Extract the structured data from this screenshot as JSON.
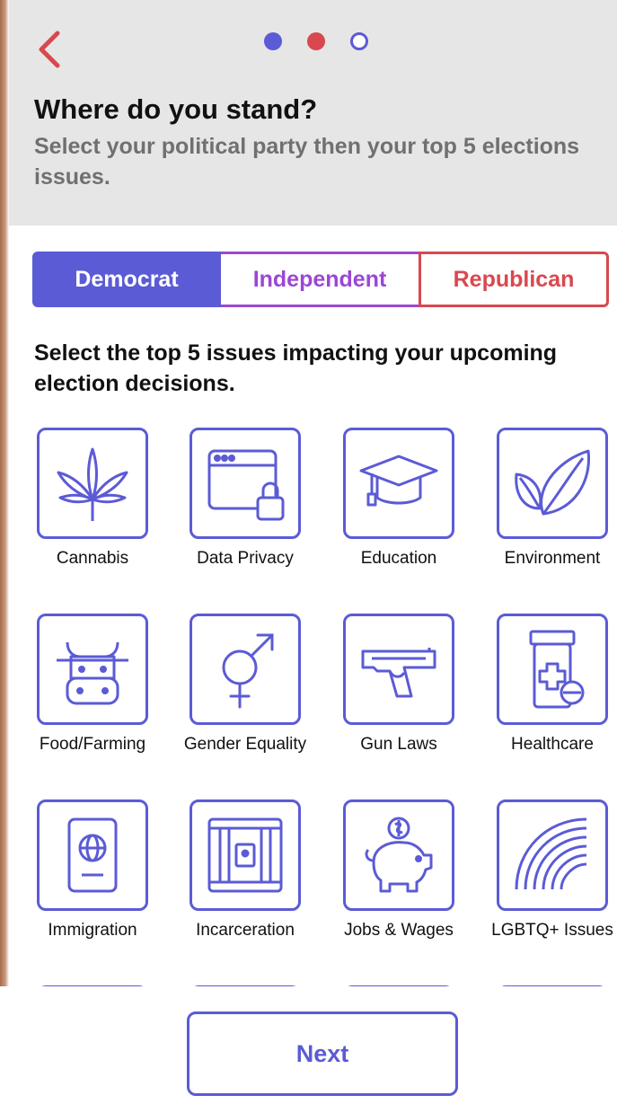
{
  "header": {
    "title": "Where do you stand?",
    "subtitle": "Select your political party then your top 5 elections issues.",
    "back_icon": "chevron-left-icon",
    "progress_dots": [
      {
        "state": "done",
        "color": "#5b5bd6"
      },
      {
        "state": "current",
        "color": "#d9484f"
      },
      {
        "state": "todo",
        "color": "#5b5bd6"
      }
    ]
  },
  "party": {
    "options": [
      "Democrat",
      "Independent",
      "Republican"
    ],
    "selected": "Democrat",
    "colors": {
      "Democrat": "#5b5bd6",
      "Independent": "#9b47d4",
      "Republican": "#d9484f"
    }
  },
  "issues": {
    "heading": "Select the top 5 issues impacting your upcoming election decisions.",
    "items": [
      {
        "label": "Cannabis",
        "icon": "cannabis-icon"
      },
      {
        "label": "Data Privacy",
        "icon": "data-privacy-icon"
      },
      {
        "label": "Education",
        "icon": "graduation-cap-icon"
      },
      {
        "label": "Environment",
        "icon": "leaves-icon"
      },
      {
        "label": "Food/Farming",
        "icon": "cow-icon"
      },
      {
        "label": "Gender Equality",
        "icon": "gender-icon"
      },
      {
        "label": "Gun Laws",
        "icon": "gun-icon"
      },
      {
        "label": "Healthcare",
        "icon": "medicine-icon"
      },
      {
        "label": "Immigration",
        "icon": "passport-icon"
      },
      {
        "label": "Incarceration",
        "icon": "jail-icon"
      },
      {
        "label": "Jobs & Wages",
        "icon": "piggy-bank-icon"
      },
      {
        "label": "LGBTQ+ Issues",
        "icon": "rainbow-icon"
      }
    ]
  },
  "footer": {
    "next_label": "Next"
  },
  "colors": {
    "accent": "#5b5bd6",
    "header_bg": "#e6e6e6",
    "subtitle": "#707070"
  }
}
